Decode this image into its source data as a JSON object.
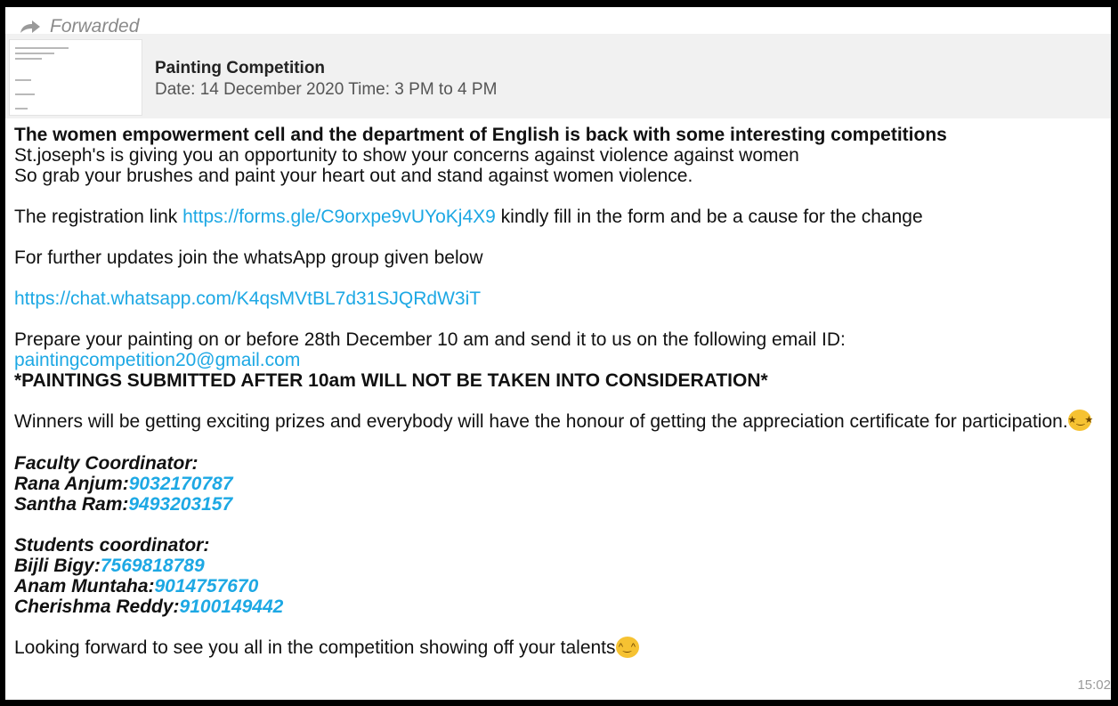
{
  "forwarded_label": "Forwarded",
  "preview": {
    "title": "Painting Competition",
    "subtitle": "Date: 14 December 2020 Time: 3 PM to 4 PM"
  },
  "message": {
    "heading": "The women empowerment cell and the department of English is back with some interesting competitions",
    "line_1": "St.joseph's is giving you an opportunity to show your concerns against violence against women",
    "line_2": "So grab your brushes and paint your heart out and stand against women violence.",
    "reg_prefix": "The registration link ",
    "reg_link": "https://forms.gle/C9orxpe9vUYoKj4X9",
    "reg_suffix": " kindly fill in the form  and be a cause for the change",
    "updates": "For further updates join the whatsApp group given below",
    "group_link": "https://chat.whatsapp.com/K4qsMVtBL7d31SJQRdW3iT",
    "prepare": "Prepare your painting on or before 28th December 10 am and send it to us on the following email ID: ",
    "email": "paintingcompetition20@gmail.com",
    "warning": "*PAINTINGS SUBMITTED AFTER 10am WILL NOT BE TAKEN INTO CONSIDERATION*",
    "winners": "Winners will be getting exciting prizes and everybody will have the honour of getting the appreciation certificate for participation.",
    "faculty_heading": "Faculty Coordinator:",
    "faculty": [
      {
        "name": "Rana Anjum:",
        "phone": "9032170787"
      },
      {
        "name": "Santha Ram:",
        "phone": "9493203157"
      }
    ],
    "students_heading": "Students coordinator:",
    "students": [
      {
        "name": "Bijli Bigy:",
        "phone": "7569818789"
      },
      {
        "name": "Anam Muntaha:",
        "phone": "9014757670"
      },
      {
        "name": "Cherishma Reddy:",
        "phone": "9100149442"
      }
    ],
    "closing": "Looking forward to see you all in the competition showing off your talents"
  },
  "timestamp": "15:02",
  "colors": {
    "link": "#1da8e4",
    "preview_bg": "#f1f1f1"
  },
  "icons": {
    "forward": "forward-arrow-icon",
    "emoji_1": "star-struck-emoji",
    "emoji_2": "smiling-emoji"
  }
}
